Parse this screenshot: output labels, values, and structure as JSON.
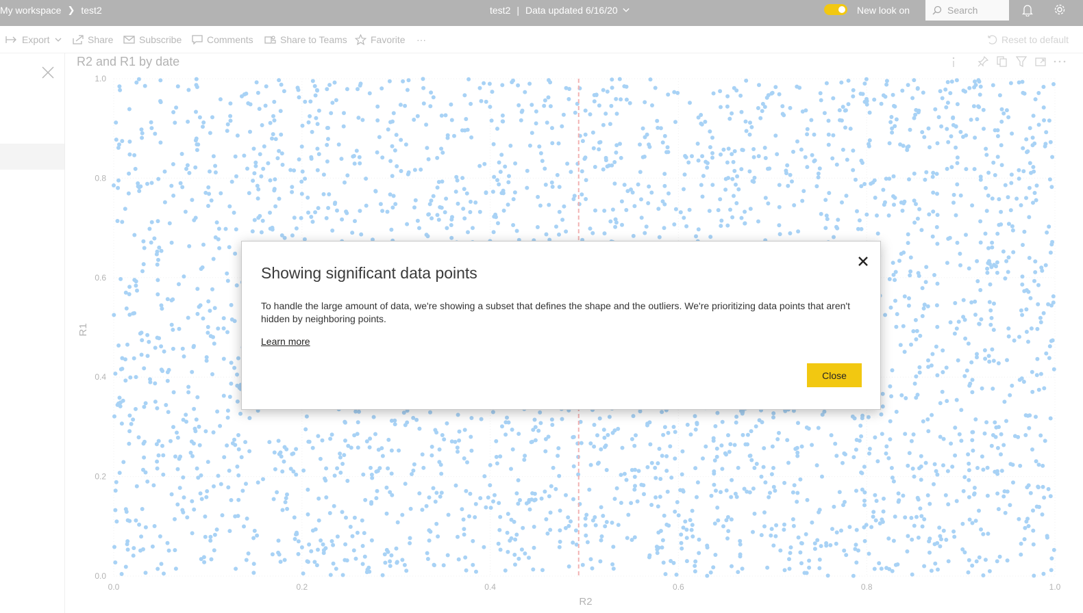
{
  "header": {
    "breadcrumb": [
      "My workspace",
      "test2"
    ],
    "report_name": "test2",
    "data_updated": "Data updated 6/16/20",
    "new_look_label": "New look on",
    "new_look_on": true,
    "search_placeholder": "Search"
  },
  "toolbar": {
    "export": "Export",
    "share": "Share",
    "subscribe": "Subscribe",
    "comments": "Comments",
    "share_teams": "Share to Teams",
    "favorite": "Favorite",
    "more": "···",
    "reset": "Reset to default"
  },
  "visual": {
    "title": "R2 and R1 by date"
  },
  "chart_data": {
    "type": "scatter",
    "title": "R2 and R1 by date",
    "xlabel": "R2",
    "ylabel": "R1",
    "xlim": [
      0.0,
      1.0
    ],
    "ylim": [
      0.0,
      1.0
    ],
    "x_ticks": [
      "0.0",
      "0.2",
      "0.4",
      "0.6",
      "0.8",
      "1.0"
    ],
    "y_ticks": [
      "0.0",
      "0.2",
      "0.4",
      "0.6",
      "0.8",
      "1.0"
    ],
    "reference_line_x": 0.494,
    "point_count_approx": 3200,
    "distribution": "uniform random over [0,1] x [0,1]",
    "point_color": "#a8d2f5",
    "reference_line_color": "#f2b3b3",
    "grid": true
  },
  "dialog": {
    "title": "Showing significant data points",
    "body": "To handle the large amount of data, we're showing a subset that defines the shape and the outliers. We're prioritizing data points that aren't hidden by neighboring points.",
    "learn_more": "Learn more",
    "close_button": "Close"
  },
  "colors": {
    "topbar": "#b3b3b3",
    "accent": "#f2c811"
  }
}
